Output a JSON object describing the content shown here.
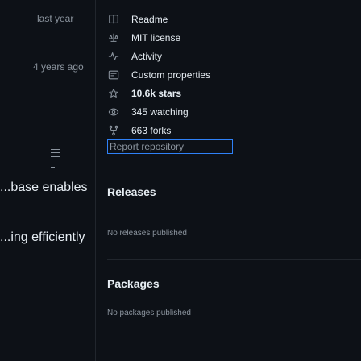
{
  "file_list": {
    "commit_times": [
      "last year",
      "4 years ago"
    ],
    "toc_icon": "list-unordered-icon"
  },
  "readme": {
    "fragments": [
      "...base enables",
      "...ing efficiently"
    ]
  },
  "about": {
    "items": [
      {
        "icon": "book-icon",
        "label": "Readme"
      },
      {
        "icon": "law-icon",
        "label": "MIT license"
      },
      {
        "icon": "pulse-icon",
        "label": "Activity"
      },
      {
        "icon": "note-icon",
        "label": "Custom properties"
      },
      {
        "icon": "star-icon",
        "label": "10.6k stars"
      },
      {
        "icon": "eye-icon",
        "label": "345 watching"
      },
      {
        "icon": "repo-forked-icon",
        "label": "663 forks"
      }
    ],
    "report_label": "Report repository"
  },
  "releases": {
    "title": "Releases",
    "note": "No releases published"
  },
  "packages": {
    "title": "Packages",
    "note": "No packages published"
  },
  "colors": {
    "background": "#0d1117",
    "text": "#e6edf3",
    "muted": "#8b949e",
    "border": "#21262d",
    "focus": "#2f81f7"
  }
}
